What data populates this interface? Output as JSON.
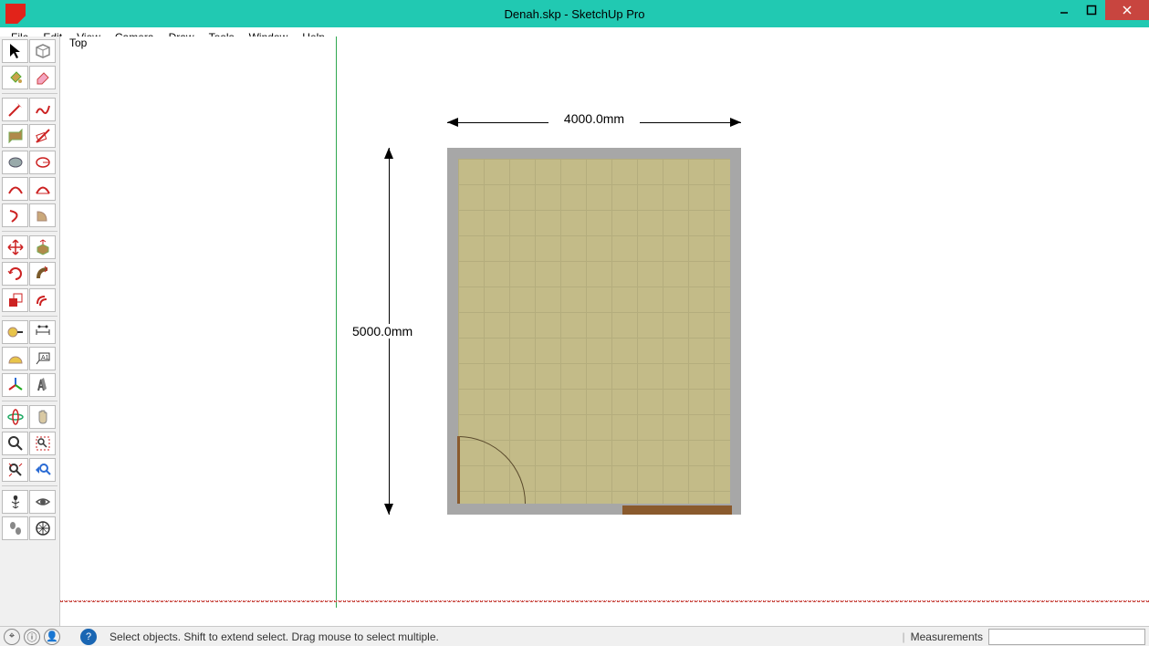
{
  "title": "Denah.skp - SketchUp Pro",
  "menu": {
    "file": "File",
    "edit": "Edit",
    "view": "View",
    "camera": "Camera",
    "draw": "Draw",
    "tools": "Tools",
    "window": "Window",
    "help": "Help"
  },
  "view_label": "Top",
  "dimensions": {
    "width_label": "4000.0mm",
    "height_label": "5000.0mm"
  },
  "statusbar": {
    "hint": "Select objects. Shift to extend select. Drag mouse to select multiple.",
    "measurements_label": "Measurements",
    "measurements_value": ""
  }
}
